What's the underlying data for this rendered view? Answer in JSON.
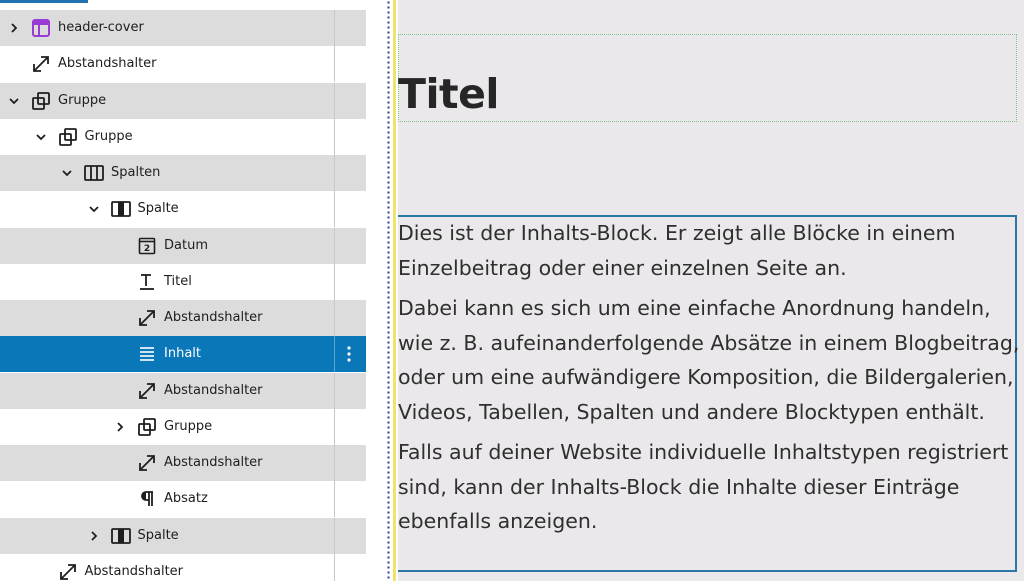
{
  "list_view": {
    "rows": [
      {
        "label": "header-cover",
        "icon": "template-part-icon",
        "expander": "chevron-right",
        "level": 0
      },
      {
        "label": "Abstandshalter",
        "icon": "spacer-icon",
        "expander": "",
        "level": 0
      },
      {
        "label": "Gruppe",
        "icon": "group-icon",
        "expander": "chevron-down",
        "level": 0
      },
      {
        "label": "Gruppe",
        "icon": "group-icon",
        "expander": "chevron-down",
        "level": 1
      },
      {
        "label": "Spalten",
        "icon": "columns-icon",
        "expander": "chevron-down",
        "level": 2
      },
      {
        "label": "Spalte",
        "icon": "column-icon",
        "expander": "chevron-down",
        "level": 3
      },
      {
        "label": "Datum",
        "icon": "date-icon",
        "expander": "",
        "level": 4
      },
      {
        "label": "Titel",
        "icon": "title-icon",
        "expander": "",
        "level": 4
      },
      {
        "label": "Abstandshalter",
        "icon": "spacer-icon",
        "expander": "",
        "level": 4
      },
      {
        "label": "Inhalt",
        "icon": "content-icon",
        "expander": "",
        "level": 4,
        "selected": true
      },
      {
        "label": "Abstandshalter",
        "icon": "spacer-icon",
        "expander": "",
        "level": 4
      },
      {
        "label": "Gruppe",
        "icon": "group-icon",
        "expander": "chevron-right",
        "level": 4
      },
      {
        "label": "Abstandshalter",
        "icon": "spacer-icon",
        "expander": "",
        "level": 4
      },
      {
        "label": "Absatz",
        "icon": "paragraph-icon",
        "expander": "",
        "level": 4
      },
      {
        "label": "Spalte",
        "icon": "column-icon",
        "expander": "chevron-right",
        "level": 3
      },
      {
        "label": "Abstandshalter",
        "icon": "spacer-icon",
        "expander": "",
        "level": 1
      }
    ],
    "date_icon_text": "2",
    "more_icon": "ellipsis-vertical-icon"
  },
  "canvas": {
    "title": "Titel",
    "content_paragraphs": [
      "Dies ist der Inhalts-Block. Er zeigt alle Blöcke in einem Einzelbeitrag oder einer einzelnen Seite an.",
      "Dabei kann es sich um eine einfache Anordnung handeln, wie z. B. aufeinanderfolgende Absätze in einem Blogbeitrag, oder um eine aufwändigere Komposition, die Bildergalerien, Videos, Tabellen, Spalten und andere Blocktypen enthält.",
      "Falls auf deiner Website individuelle Inhaltstypen registriert sind, kann der Inhalts-Block die Inhalte dieser Einträge ebenfalls anzeigen."
    ]
  },
  "colors": {
    "selected_row": "#0a77b8",
    "row_gray": "#dcdcdc",
    "canvas_bg": "#eae8ea",
    "content_outline": "#2d77a8",
    "template_part_icon": "#9b3bd6"
  }
}
